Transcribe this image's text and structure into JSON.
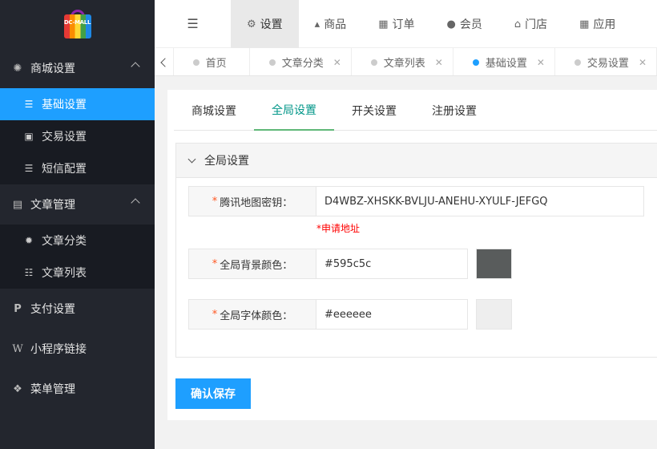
{
  "logo": {
    "text": "DC-MALL"
  },
  "sidebar": {
    "groups": [
      {
        "label": "商城设置",
        "icon": "gear-icon",
        "expanded": true,
        "items": [
          {
            "label": "基础设置",
            "icon": "list-icon",
            "active": true
          },
          {
            "label": "交易设置",
            "icon": "id-card-icon"
          },
          {
            "label": "短信配置",
            "icon": "list-icon"
          }
        ]
      },
      {
        "label": "文章管理",
        "icon": "newspaper-icon",
        "expanded": true,
        "items": [
          {
            "label": "文章分类",
            "icon": "gear-icon"
          },
          {
            "label": "文章列表",
            "icon": "list-bullets-icon"
          }
        ]
      },
      {
        "label": "支付设置",
        "icon": "paypal-icon"
      },
      {
        "label": "小程序链接",
        "icon": "w-icon"
      },
      {
        "label": "菜单管理",
        "icon": "cubes-icon"
      }
    ]
  },
  "topnav": {
    "items": [
      {
        "label": "设置",
        "icon": "gears-icon",
        "active": true
      },
      {
        "label": "商品",
        "icon": "shopping-bag-icon"
      },
      {
        "label": "订单",
        "icon": "table-icon"
      },
      {
        "label": "会员",
        "icon": "user-icon"
      },
      {
        "label": "门店",
        "icon": "bank-icon"
      },
      {
        "label": "应用",
        "icon": "grid-icon"
      }
    ]
  },
  "tabs": [
    {
      "label": "首页",
      "closable": false
    },
    {
      "label": "文章分类",
      "closable": true
    },
    {
      "label": "文章列表",
      "closable": true
    },
    {
      "label": "基础设置",
      "closable": true,
      "active": true
    },
    {
      "label": "交易设置",
      "closable": true
    }
  ],
  "subtabs": [
    {
      "label": "商城设置"
    },
    {
      "label": "全局设置",
      "active": true
    },
    {
      "label": "开关设置"
    },
    {
      "label": "注册设置"
    }
  ],
  "panel": {
    "title": "全局设置",
    "fields": {
      "map_key": {
        "label": "腾讯地图密钥：",
        "value": "D4WBZ-XHSKK-BVLJU-ANEHU-XYULF-JEFGQ"
      },
      "apply_link": "*申请地址",
      "bg_color": {
        "label": "全局背景颜色：",
        "value": "#595c5c"
      },
      "font_color": {
        "label": "全局字体颜色：",
        "value": "#eeeeee"
      }
    }
  },
  "actions": {
    "save_label": "确认保存"
  },
  "colors": {
    "accent": "#1e9fff",
    "sidebar_bg": "#23262e",
    "tab_active": "#009688",
    "required": "#ff5722"
  }
}
